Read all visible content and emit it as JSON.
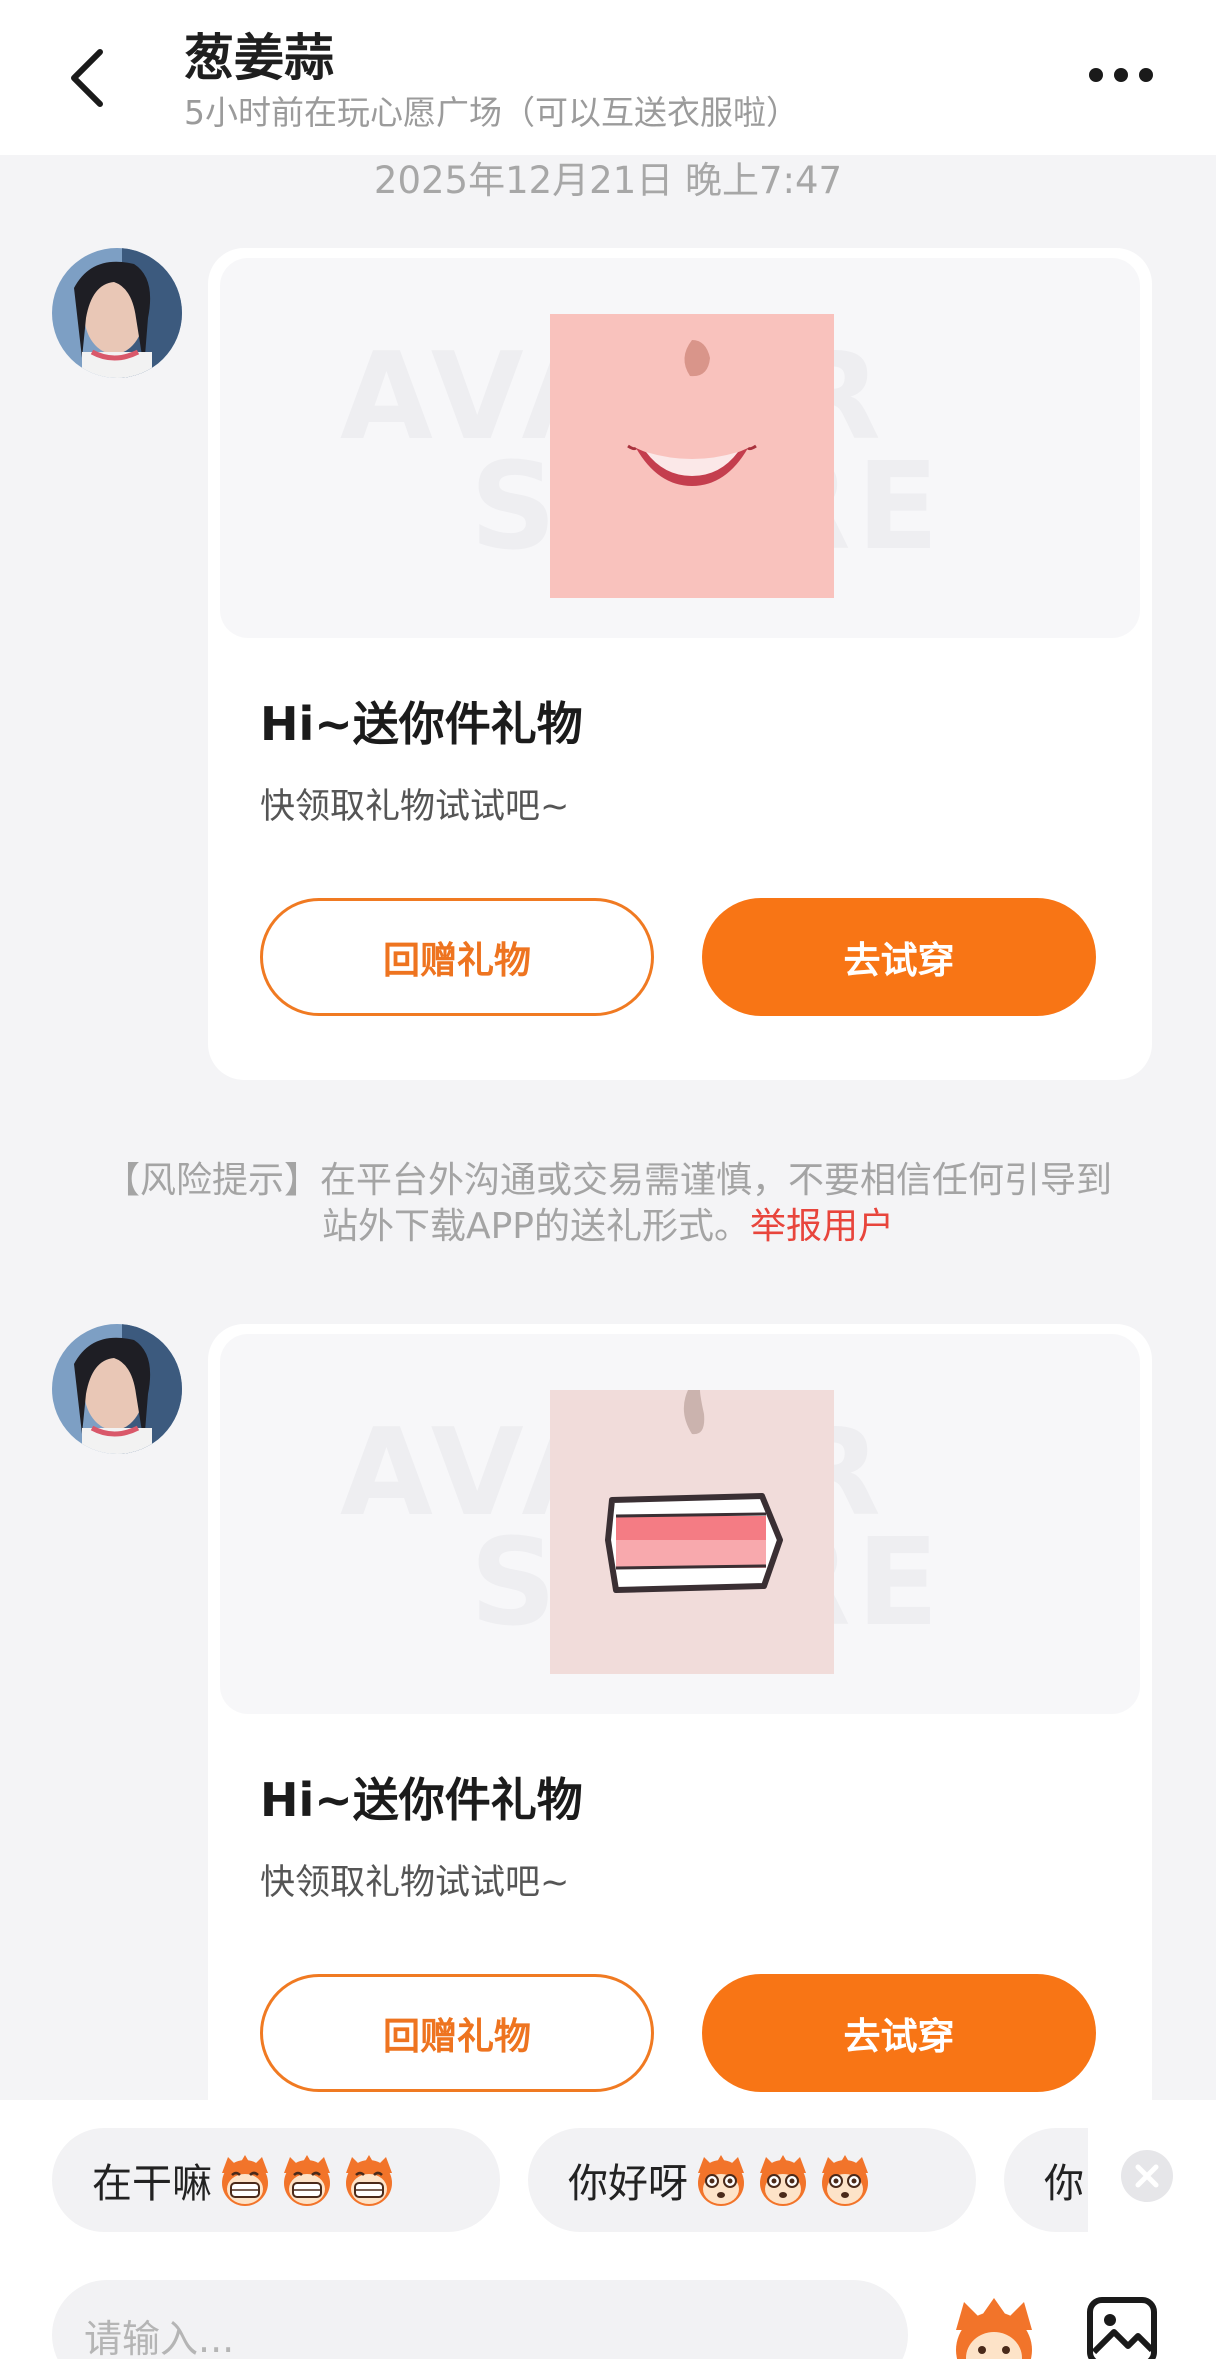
{
  "header": {
    "title": "葱姜蒜",
    "subtitle": "5小时前在玩心愿广场（可以互送衣服啦）"
  },
  "chat": {
    "timestamp": "2025年12月21日 晚上7:47",
    "messages": [
      {
        "title": "Hi~送你件礼物",
        "description": "快领取礼物试试吧~",
        "return_gift_label": "回赠礼物",
        "try_on_label": "去试穿"
      },
      {
        "title": "Hi~送你件礼物",
        "description": "快领取礼物试试吧~",
        "return_gift_label": "回赠礼物",
        "try_on_label": "去试穿"
      }
    ],
    "watermark": [
      "AVATAR",
      "STORE"
    ],
    "risk_notice": "【风险提示】在平台外沟通或交易需谨慎，不要相信任何引导到站外下载APP的送礼形式。",
    "report_label": "举报用户"
  },
  "quick_replies": [
    "在干嘛",
    "你好呀",
    "你"
  ],
  "input": {
    "placeholder": "请输入..."
  },
  "colors": {
    "accent": "#f87515",
    "report": "#e8453c"
  },
  "icons": [
    "back-arrow-icon",
    "more-dots-icon",
    "grin-monkey-emoji",
    "surprised-monkey-emoji",
    "close-icon",
    "mascot-icon",
    "image-icon"
  ]
}
